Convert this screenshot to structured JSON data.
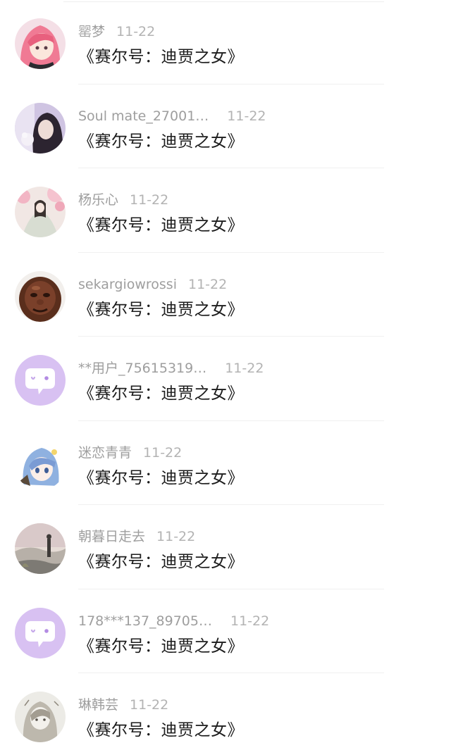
{
  "comments": [
    {
      "user": "罂梦",
      "date": "11-22",
      "text": "《赛尔号：迪贾之女》",
      "avatar": "pink-hair-anime-avatar"
    },
    {
      "user": "Soul mate_27001…",
      "date": "11-22",
      "text": "《赛尔号：迪贾之女》",
      "avatar": "girl-photo-avatar"
    },
    {
      "user": "杨乐心",
      "date": "11-22",
      "text": "《赛尔号：迪贾之女》",
      "avatar": "painted-blossom-avatar"
    },
    {
      "user": "sekargiowrossi",
      "date": "11-22",
      "text": "《赛尔号：迪贾之女》",
      "avatar": "buddha-statue-avatar"
    },
    {
      "user": "**用户_75615319…",
      "date": "11-22",
      "text": "《赛尔号：迪贾之女》",
      "avatar": "default-chat-avatar"
    },
    {
      "user": "迷恋青青",
      "date": "11-22",
      "text": "《赛尔号：迪贾之女》",
      "avatar": "blue-hair-anime-avatar"
    },
    {
      "user": "朝暮日走去",
      "date": "11-22",
      "text": "《赛尔号：迪贾之女》",
      "avatar": "misty-landscape-avatar"
    },
    {
      "user": "178***137_89705…",
      "date": "11-22",
      "text": "《赛尔号：迪贾之女》",
      "avatar": "default-chat-avatar"
    },
    {
      "user": "琳韩芸",
      "date": "11-22",
      "text": "《赛尔号：迪贾之女》",
      "avatar": "sketch-girl-avatar"
    }
  ],
  "colors": {
    "default_avatar_bg": "#d8c1f2",
    "username": "#9e9e9e",
    "date": "#b3b3b3",
    "text": "#1c1c1c"
  }
}
